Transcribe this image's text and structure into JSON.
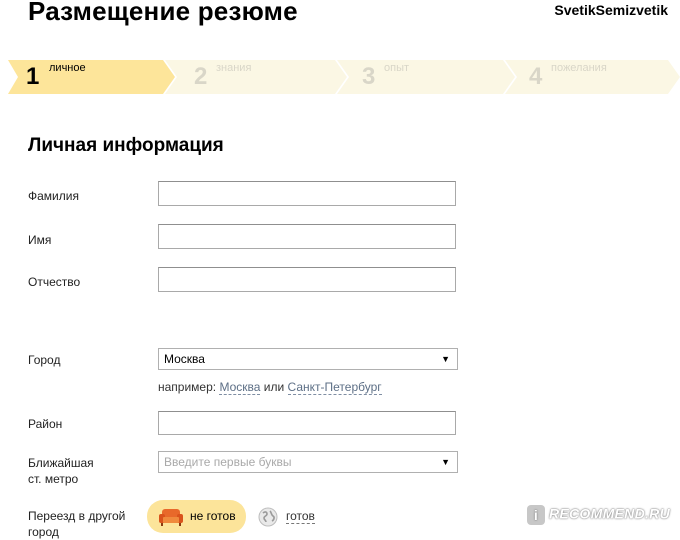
{
  "header": {
    "title": "Размещение резюме",
    "username": "SvetikSemizvetik"
  },
  "steps": [
    {
      "num": "1",
      "label": "личное",
      "active": true
    },
    {
      "num": "2",
      "label": "знания",
      "active": false
    },
    {
      "num": "3",
      "label": "опыт",
      "active": false
    },
    {
      "num": "4",
      "label": "пожелания",
      "active": false
    }
  ],
  "colors": {
    "active_step": "#fde59a",
    "inactive_step": "#fbf7e4",
    "toggle_selected": "#fce49a"
  },
  "form": {
    "section_title": "Личная информация",
    "surname_label": "Фамилия",
    "name_label": "Имя",
    "patronymic_label": "Отчество",
    "city_label": "Город",
    "city_value": "Москва",
    "city_hint_prefix": "например:",
    "city_hint_link1": "Москва",
    "city_hint_or": "или",
    "city_hint_link2": "Санкт-Петербург",
    "district_label": "Район",
    "metro_label_line1": "Ближайшая",
    "metro_label_line2": "ст. метро",
    "metro_placeholder": "Введите первые буквы",
    "relocation_label_line1": "Переезд в другой",
    "relocation_label_line2": "город",
    "relocation_not_ready": "не готов",
    "relocation_ready": "готов"
  },
  "watermark": {
    "badge": "i",
    "text": "RECOMMEND.RU"
  }
}
